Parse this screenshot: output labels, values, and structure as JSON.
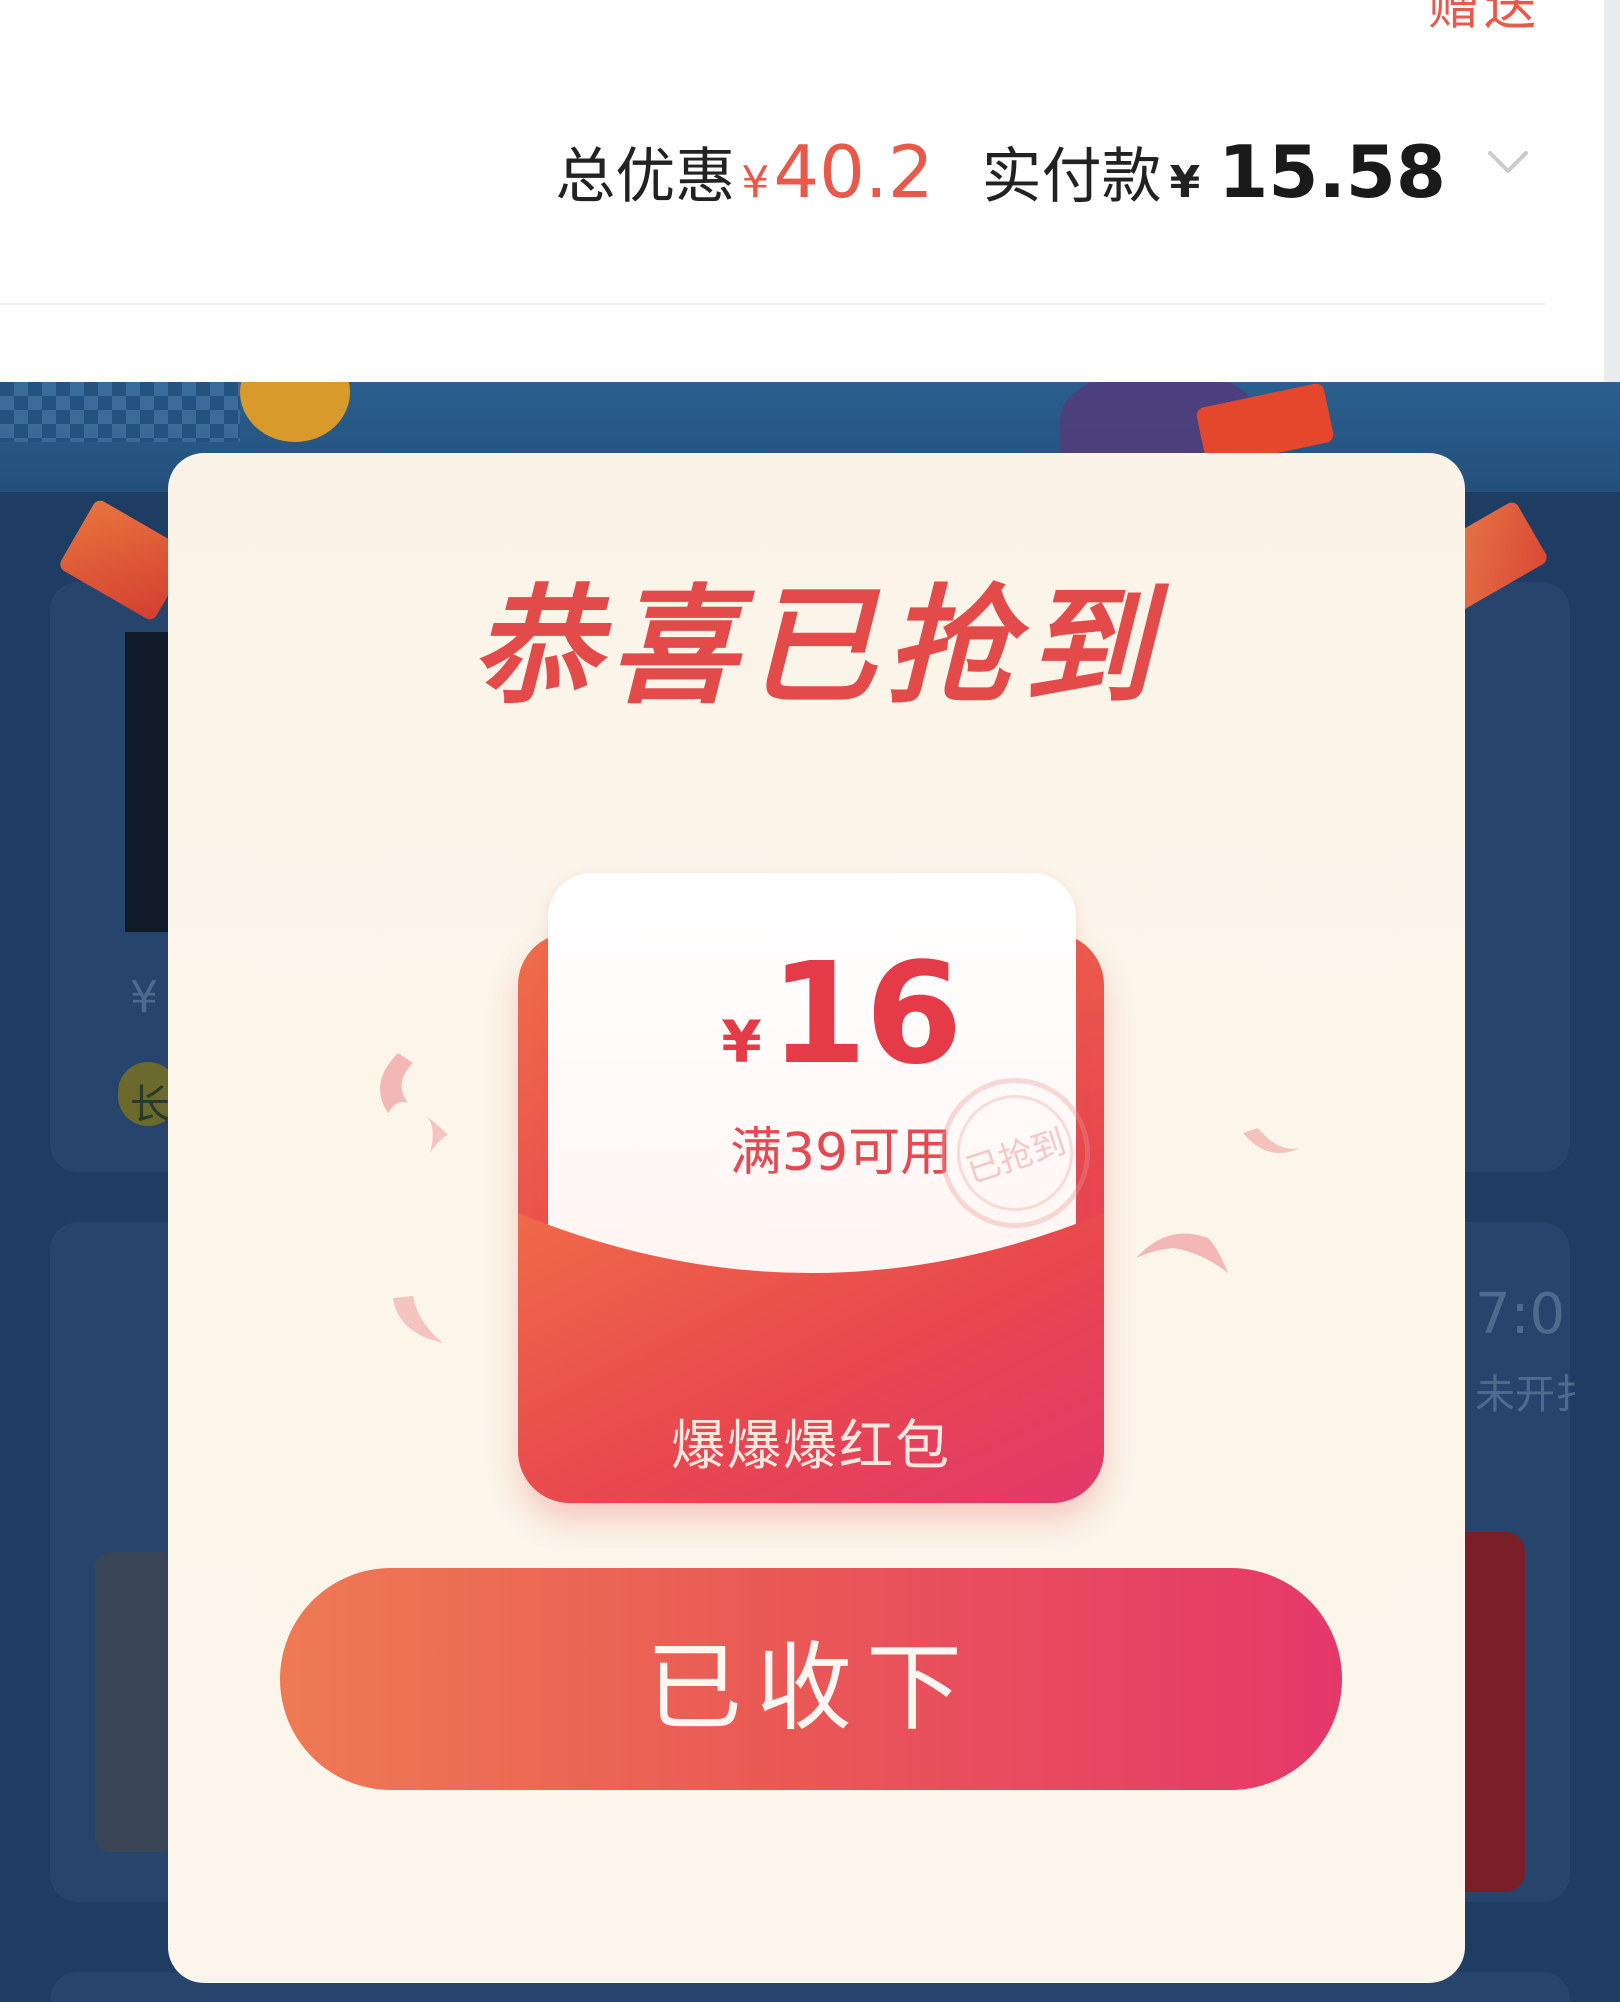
{
  "order_summary": {
    "cut_text": "赠送",
    "discount_label": "总优惠",
    "discount_currency": "¥",
    "discount_amount": "40.2",
    "paid_label": "实付款",
    "paid_currency": "¥",
    "paid_amount": "15.58",
    "expand_icon": "chevron-down-icon"
  },
  "background_page": {
    "partial_price": "¥",
    "partial_tag": "长",
    "partial_time": "7:0",
    "partial_status": "未开扌"
  },
  "modal": {
    "title": "恭喜已抢到",
    "red_packet": {
      "currency": "¥",
      "amount": "16",
      "threshold": "满39可用",
      "stamp": "已抢到",
      "name": "爆爆爆红包"
    },
    "button_label": "已收下"
  },
  "colors": {
    "accent_red": "#e34a4a",
    "price_red": "#e8594a",
    "button_gradient_start": "#ee7a54",
    "button_gradient_end": "#e5386a",
    "modal_bg": "#fbf5ea",
    "background_navy": "#1f3d63"
  }
}
